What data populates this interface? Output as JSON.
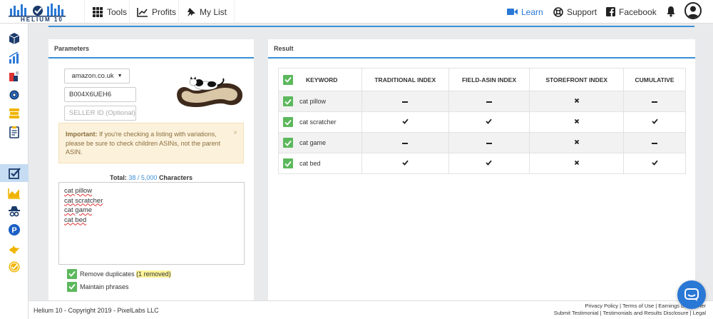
{
  "brand": {
    "logo_text": "HELIUM 10"
  },
  "nav": {
    "tools": "Tools",
    "profits": "Profits",
    "my_list": "My List",
    "learn": "Learn",
    "support": "Support",
    "facebook": "Facebook"
  },
  "sidebar": {
    "items": [
      "black-box-icon",
      "magnet-icon",
      "misspellinator-icon",
      "scribbles-icon",
      "index-checker-icon",
      "frankenstein-icon",
      "keyword-tracker-icon",
      "trendster-icon",
      "inventory-protector-icon",
      "profits-icon",
      "genie-icon",
      "alerts-icon"
    ],
    "active_index": 6
  },
  "parameters": {
    "title": "Parameters",
    "marketplace": "amazon.co.uk",
    "asin_value": "B004X6UEH6",
    "seller_placeholder": "SELLER ID (Optional)",
    "alert": {
      "bold": "Important:",
      "text": " If you're checking a listing with variations, please be sure to check children ASINs, not the parent ASIN.",
      "close": "×"
    },
    "total_label": "Total:",
    "total_count": "38 / 5,000",
    "total_suffix": "Characters",
    "keywords": [
      "cat pillow",
      "cat scratcher",
      "cat game",
      "cat bed"
    ],
    "remove_duplicates": "Remove duplicates",
    "removed_note": "(1 removed)",
    "maintain_phrases": "Maintain phrases"
  },
  "result": {
    "title": "Result",
    "headers": [
      "Keyword",
      "Traditional Index",
      "Field-Asin Index",
      "Storefront Index",
      "Cumulative"
    ],
    "rows": [
      {
        "keyword": "cat pillow",
        "traditional": "dash",
        "field_asin": "dash",
        "storefront": "x",
        "cumulative": "dash"
      },
      {
        "keyword": "cat scratcher",
        "traditional": "check",
        "field_asin": "check",
        "storefront": "x",
        "cumulative": "check"
      },
      {
        "keyword": "cat game",
        "traditional": "dash",
        "field_asin": "dash",
        "storefront": "x",
        "cumulative": "dash"
      },
      {
        "keyword": "cat bed",
        "traditional": "check",
        "field_asin": "check",
        "storefront": "x",
        "cumulative": "check"
      }
    ]
  },
  "footer": {
    "copyright": "Helium 10 - Copyright 2019 - PixelLabs LLC",
    "links_line1": "Privacy Policy | Terms of Use | Earnings Disclaimer",
    "links_line2": "Submit Testimonial | Testimonials and Results Disclosure | Legal"
  },
  "colors": {
    "accent": "#3a8fd6",
    "check_green": "#5cb85c",
    "alert_bg": "#fcf2dc",
    "learn_blue": "#2a78d6"
  }
}
